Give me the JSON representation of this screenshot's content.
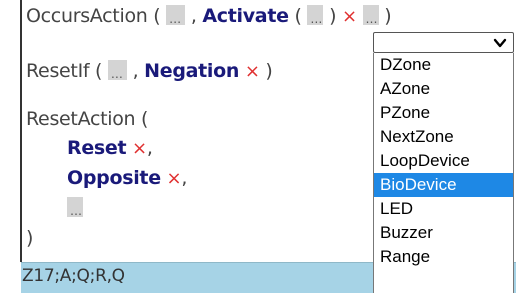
{
  "editor": {
    "occurs": {
      "name": "OccursAction (",
      "sep": ",",
      "activate": "Activate",
      "activate_open": "(",
      "close1": ")",
      "remove": "×",
      "close2": ")"
    },
    "reset_if": {
      "name": "ResetIf (",
      "sep": ",",
      "negation": "Negation",
      "remove": "×",
      "close": ")"
    },
    "reset_action": {
      "name": "ResetAction (",
      "reset": "Reset",
      "reset_remove": "×",
      "reset_sep": ",",
      "opposite": "Opposite",
      "opposite_remove": "×",
      "opposite_sep": ",",
      "close": ")"
    }
  },
  "status": {
    "text": "Z17;A;Q;R,Q",
    "color": "#a6d3e6"
  },
  "dropdown": {
    "selected_value": "",
    "options": [
      "DZone",
      "AZone",
      "PZone",
      "NextZone",
      "LoopDevice",
      "BioDevice",
      "LED",
      "Buzzer",
      "Range"
    ],
    "highlighted": "BioDevice",
    "highlight_color": "#1e88e5"
  },
  "colors": {
    "keyword": "#1a1a7a",
    "remove": "#e03030",
    "hole": "#d4d4d4"
  }
}
